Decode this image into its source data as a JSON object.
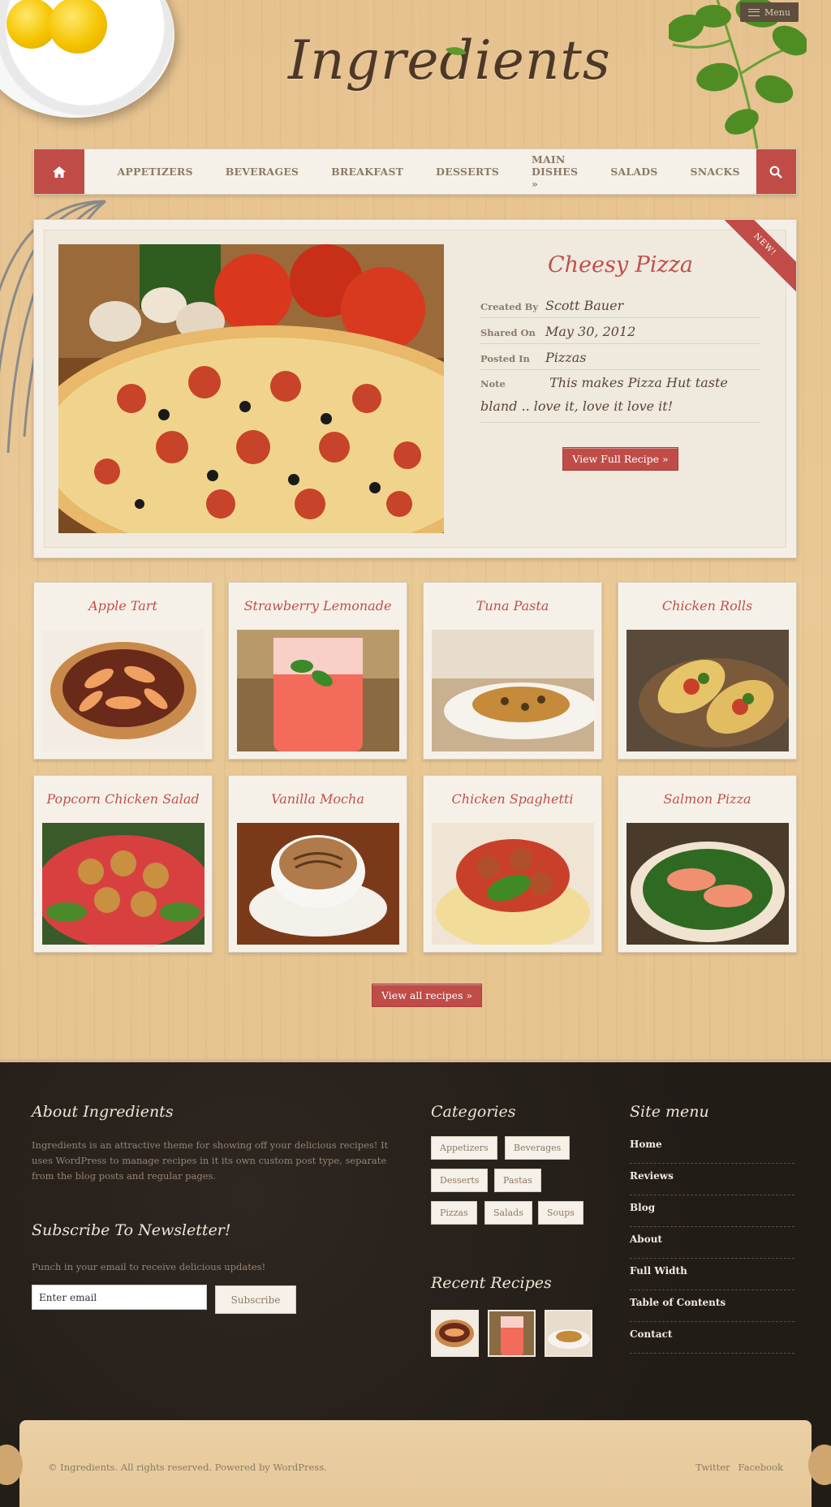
{
  "header": {
    "logo": "Ingredients",
    "menu_toggle": "Menu"
  },
  "nav": {
    "items": [
      "APPETIZERS",
      "BEVERAGES",
      "BREAKFAST",
      "DESSERTS",
      "MAIN DISHES »",
      "SALADS",
      "SNACKS"
    ]
  },
  "featured": {
    "ribbon": "NEW!",
    "title": "Cheesy Pizza",
    "created_by_label": "Created By",
    "created_by": "Scott Bauer",
    "shared_on_label": "Shared On",
    "shared_on": "May 30, 2012",
    "posted_in_label": "Posted In",
    "posted_in": "Pizzas",
    "note_label": "Note",
    "note": "This makes Pizza Hut taste bland .. love it, love it love it!",
    "button": "View Full Recipe »"
  },
  "recipes": [
    {
      "title": "Apple Tart"
    },
    {
      "title": "Strawberry Lemonade"
    },
    {
      "title": "Tuna Pasta"
    },
    {
      "title": "Chicken Rolls"
    },
    {
      "title": "Popcorn Chicken Salad"
    },
    {
      "title": "Vanilla Mocha"
    },
    {
      "title": "Chicken Spaghetti"
    },
    {
      "title": "Salmon Pizza"
    }
  ],
  "view_all": "View all recipes »",
  "footer": {
    "about_heading": "About Ingredients",
    "about_text": "Ingredients is an attractive theme for showing off your delicious recipes! It uses WordPress to manage recipes in it its own custom post type, separate from the blog posts and regular pages.",
    "newsletter_heading": "Subscribe To Newsletter!",
    "newsletter_text": "Punch in your email to receive delicious updates!",
    "email_value": "Enter email",
    "subscribe": "Subscribe",
    "categories_heading": "Categories",
    "categories": [
      "Appetizers",
      "Beverages",
      "Desserts",
      "Pastas",
      "Pizzas",
      "Salads",
      "Soups"
    ],
    "recent_heading": "Recent Recipes",
    "site_menu_heading": "Site menu",
    "site_menu": [
      "Home",
      "Reviews",
      "Blog",
      "About",
      "Full Width",
      "Table of Contents",
      "Contact"
    ],
    "copyright": "© Ingredients. All rights reserved. Powered by WordPress.",
    "social": [
      "Twitter",
      "Facebook"
    ]
  },
  "colors": {
    "accent": "#c04c48",
    "card_bg": "#f6f1e8",
    "footer_bg": "#221c17"
  }
}
